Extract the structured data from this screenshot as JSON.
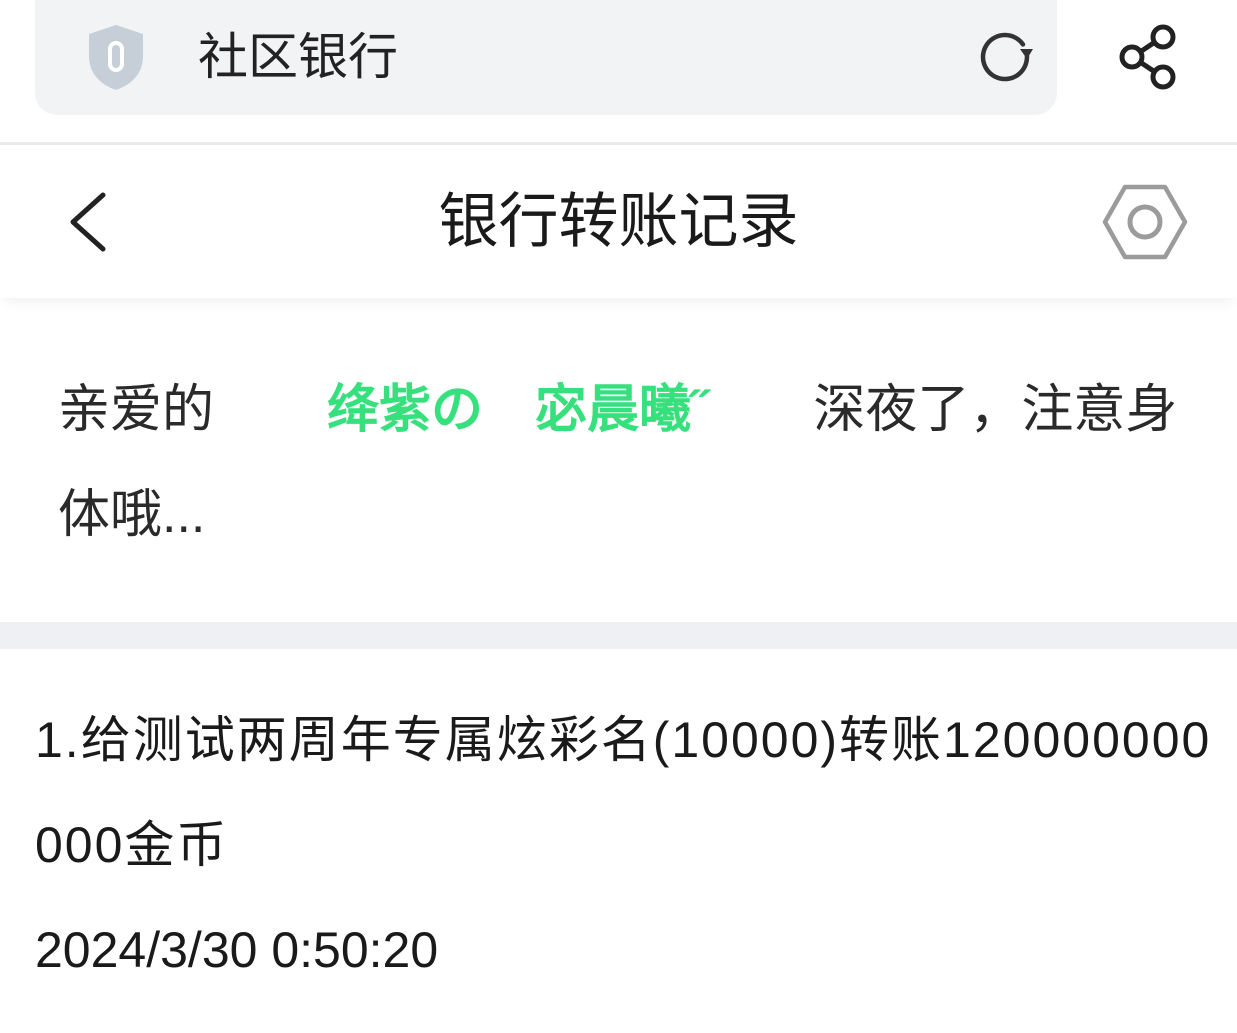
{
  "address_bar": {
    "title": "社区银行",
    "shield_icon": "shield-icon",
    "refresh_icon": "refresh-icon"
  },
  "share_icon": "share-icon",
  "header": {
    "title": "银行转账记录",
    "back_icon": "chevron-left-icon",
    "settings_icon": "settings-icon"
  },
  "greeting": {
    "prefix": "亲爱的",
    "name": "绛紫の　宓晨曦˝",
    "suffix": "深夜了，注意身体哦..."
  },
  "records": [
    {
      "text": "1.给测试两周年专属炫彩名(10000)转账120000000000金币",
      "time": "2024/3/30 0:50:20"
    }
  ],
  "colors": {
    "accent_green": "#36e07d"
  }
}
